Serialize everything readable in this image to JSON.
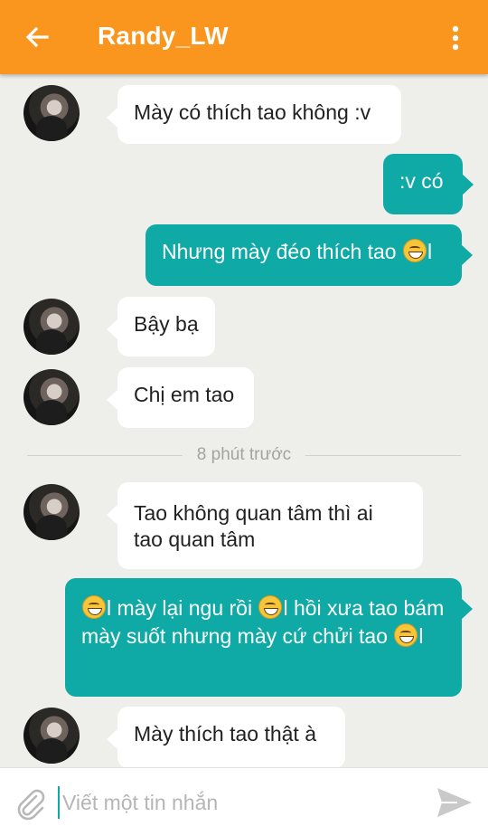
{
  "header": {
    "title": "Randy_LW",
    "back_icon": "arrow-left-icon",
    "menu_icon": "more-vertical-icon",
    "color": "#fa951d"
  },
  "messages": [
    {
      "dir": "in",
      "text": "Mày có thích tao không :v"
    },
    {
      "dir": "out",
      "text": ":v có"
    },
    {
      "dir": "out",
      "text": "Nhưng mày đéo thích tao",
      "after_emoji": "l"
    },
    {
      "dir": "in",
      "text": "Bậy bạ"
    },
    {
      "dir": "in",
      "text": "Chị em tao"
    },
    {
      "dir": "in",
      "text": "Tao không quan tâm thì ai tao quan tâm"
    },
    {
      "dir": "out",
      "parts": [
        "l mày lại ngu rồi ",
        "l hồi xưa tao bám mày suốt nhưng mày cứ chửi tao ",
        "l"
      ]
    },
    {
      "dir": "in",
      "text": "Mày thích tao thật à"
    }
  ],
  "divider": {
    "label": "8 phút trước"
  },
  "composer": {
    "placeholder": "Viết một tin nhắn",
    "attach_icon": "paperclip-icon",
    "send_icon": "send-icon"
  },
  "colors": {
    "outgoing_bubble": "#0fa9a6",
    "incoming_bubble": "#ffffff",
    "background": "#eeeeea"
  }
}
